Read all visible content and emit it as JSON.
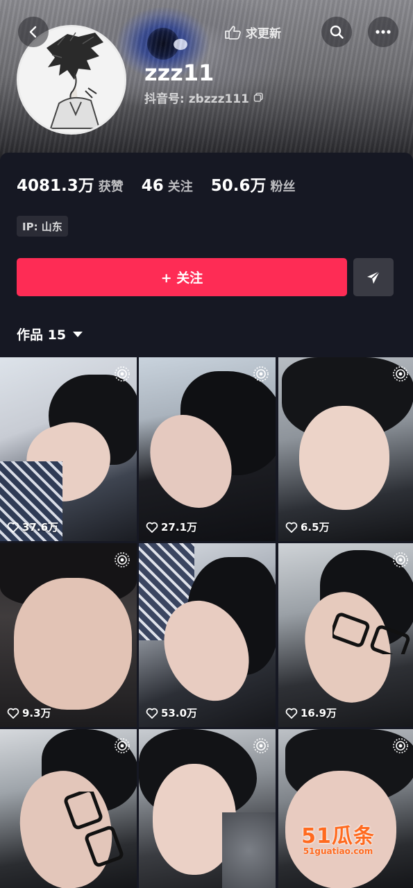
{
  "header": {
    "update_label": "求更新"
  },
  "profile": {
    "username": "zzz11",
    "douyin_id": "抖音号: zbzzz111"
  },
  "stats": [
    {
      "value": "4081.3万",
      "label": "获赞"
    },
    {
      "value": "46",
      "label": "关注"
    },
    {
      "value": "50.6万",
      "label": "粉丝"
    }
  ],
  "ip_label": "IP: 山东",
  "follow_label": "+ 关注",
  "works": {
    "label": "作品 15"
  },
  "videos": [
    {
      "likes": "37.6万"
    },
    {
      "likes": "27.1万"
    },
    {
      "likes": "6.5万"
    },
    {
      "likes": "9.3万"
    },
    {
      "likes": "53.0万"
    },
    {
      "likes": "16.9万"
    },
    {
      "likes": ""
    },
    {
      "likes": ""
    },
    {
      "likes": ""
    }
  ],
  "watermark": {
    "brand": "51瓜条",
    "url": "51guatiao.com"
  },
  "colors": {
    "accent": "#fe2c55",
    "background": "#161823"
  }
}
